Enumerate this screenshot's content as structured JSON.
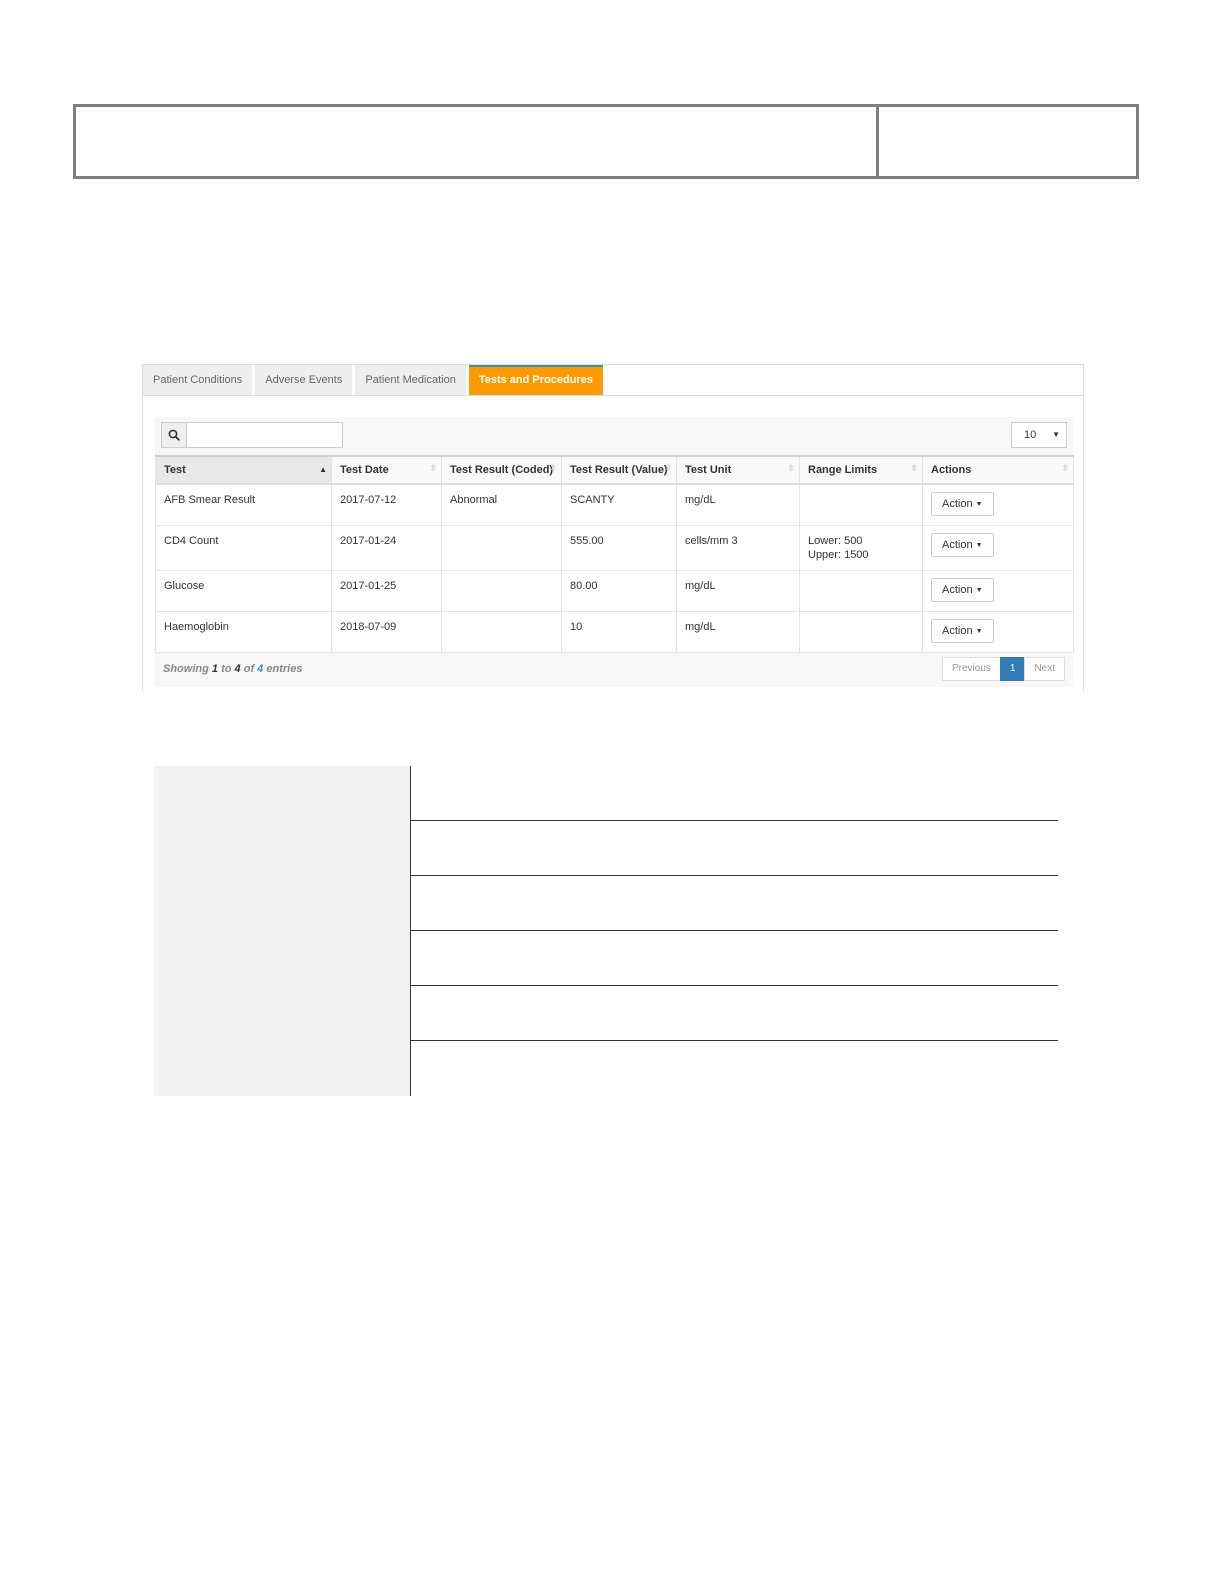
{
  "tabs": [
    {
      "label": "Patient Conditions",
      "active": false
    },
    {
      "label": "Adverse Events",
      "active": false
    },
    {
      "label": "Patient Medication",
      "active": false
    },
    {
      "label": "Tests and Procedures",
      "active": true
    }
  ],
  "search": {
    "value": "",
    "placeholder": ""
  },
  "page_length": {
    "selected": "10"
  },
  "table": {
    "columns": [
      "Test",
      "Test Date",
      "Test Result (Coded)",
      "Test Result (Value)",
      "Test Unit",
      "Range Limits",
      "Actions"
    ],
    "rows": [
      {
        "test": "AFB Smear Result",
        "date": "2017-07-12",
        "coded": "Abnormal",
        "value": "SCANTY",
        "unit": "mg/dL",
        "range_lower": "",
        "range_upper": "",
        "action": "Action"
      },
      {
        "test": "CD4 Count",
        "date": "2017-01-24",
        "coded": "",
        "value": "555.00",
        "unit": "cells/mm 3",
        "range_lower": "Lower: 500",
        "range_upper": "Upper: 1500",
        "action": "Action"
      },
      {
        "test": "Glucose",
        "date": "2017-01-25",
        "coded": "",
        "value": "80.00",
        "unit": "mg/dL",
        "range_lower": "",
        "range_upper": "",
        "action": "Action"
      },
      {
        "test": "Haemoglobin",
        "date": "2018-07-09",
        "coded": "",
        "value": "10",
        "unit": "mg/dL",
        "range_lower": "",
        "range_upper": "",
        "action": "Action"
      }
    ]
  },
  "info": {
    "showing": "Showing",
    "from": "1",
    "to_word": "to",
    "to": "4",
    "of_word": "of",
    "total": "4",
    "entries": "entries"
  },
  "pagination": {
    "previous": "Previous",
    "current": "1",
    "next": "Next"
  },
  "icons": {
    "search": "search-icon",
    "sort": "sort-icon",
    "sort_asc": "sort-asc-icon",
    "caret": "caret-down-icon"
  },
  "colors": {
    "active_tab": "#ff9900",
    "active_tab_border": "#3c8dbc",
    "current_page": "#337ab7"
  }
}
